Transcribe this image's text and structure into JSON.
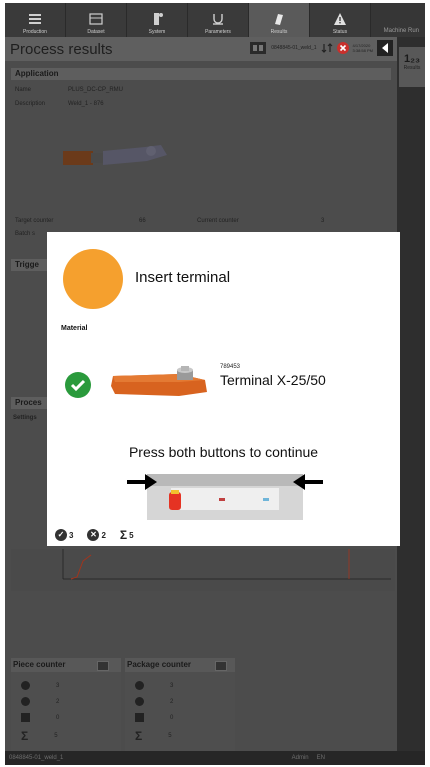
{
  "nav": [
    {
      "label": "Production",
      "icon": "grid-icon"
    },
    {
      "label": "Dataset",
      "icon": "dataset-icon"
    },
    {
      "label": "System",
      "icon": "system-icon"
    },
    {
      "label": "Parameters",
      "icon": "parameters-icon"
    },
    {
      "label": "Results",
      "icon": "results-icon"
    },
    {
      "label": "Status",
      "icon": "warning-icon"
    }
  ],
  "machine": "Machine Run",
  "title": "Process results",
  "file": "0848845-01_weld_1",
  "date": "4/17/2020",
  "time": "3:38:58 PM",
  "side_tab": {
    "number": "1₂₃",
    "label": "Results"
  },
  "application": {
    "header": "Application",
    "name_label": "Name",
    "name_value": "PLUS_DC-CP_RMU",
    "desc_label": "Description",
    "desc_value": "Weld_1 - 876",
    "target_label": "Target counter",
    "target_value": "66",
    "current_label": "Current counter",
    "current_value": "3",
    "batch_label": "Batch s"
  },
  "trigger_header": "Trigge",
  "process_header": "Proces",
  "settings_label": "Settings",
  "dialog": {
    "instruction": "Insert terminal",
    "material_label": "Material",
    "part_number": "789453",
    "part_name": "Terminal X-25/50",
    "press_text": "Press both buttons to continue",
    "ok_count": "3",
    "nok_count": "2",
    "total_count": "5"
  },
  "piece_counter": {
    "title": "Piece counter",
    "values": [
      "3",
      "2",
      "0",
      "5"
    ]
  },
  "package_counter": {
    "title": "Package counter",
    "values": [
      "3",
      "2",
      "0",
      "5"
    ]
  },
  "status": {
    "file": "0848845-01_weld_1",
    "user": "Admin",
    "lang": "EN"
  },
  "colors": {
    "accent": "#f5a02e",
    "ok": "#2a9a3c",
    "terminal": "#d8631f"
  }
}
